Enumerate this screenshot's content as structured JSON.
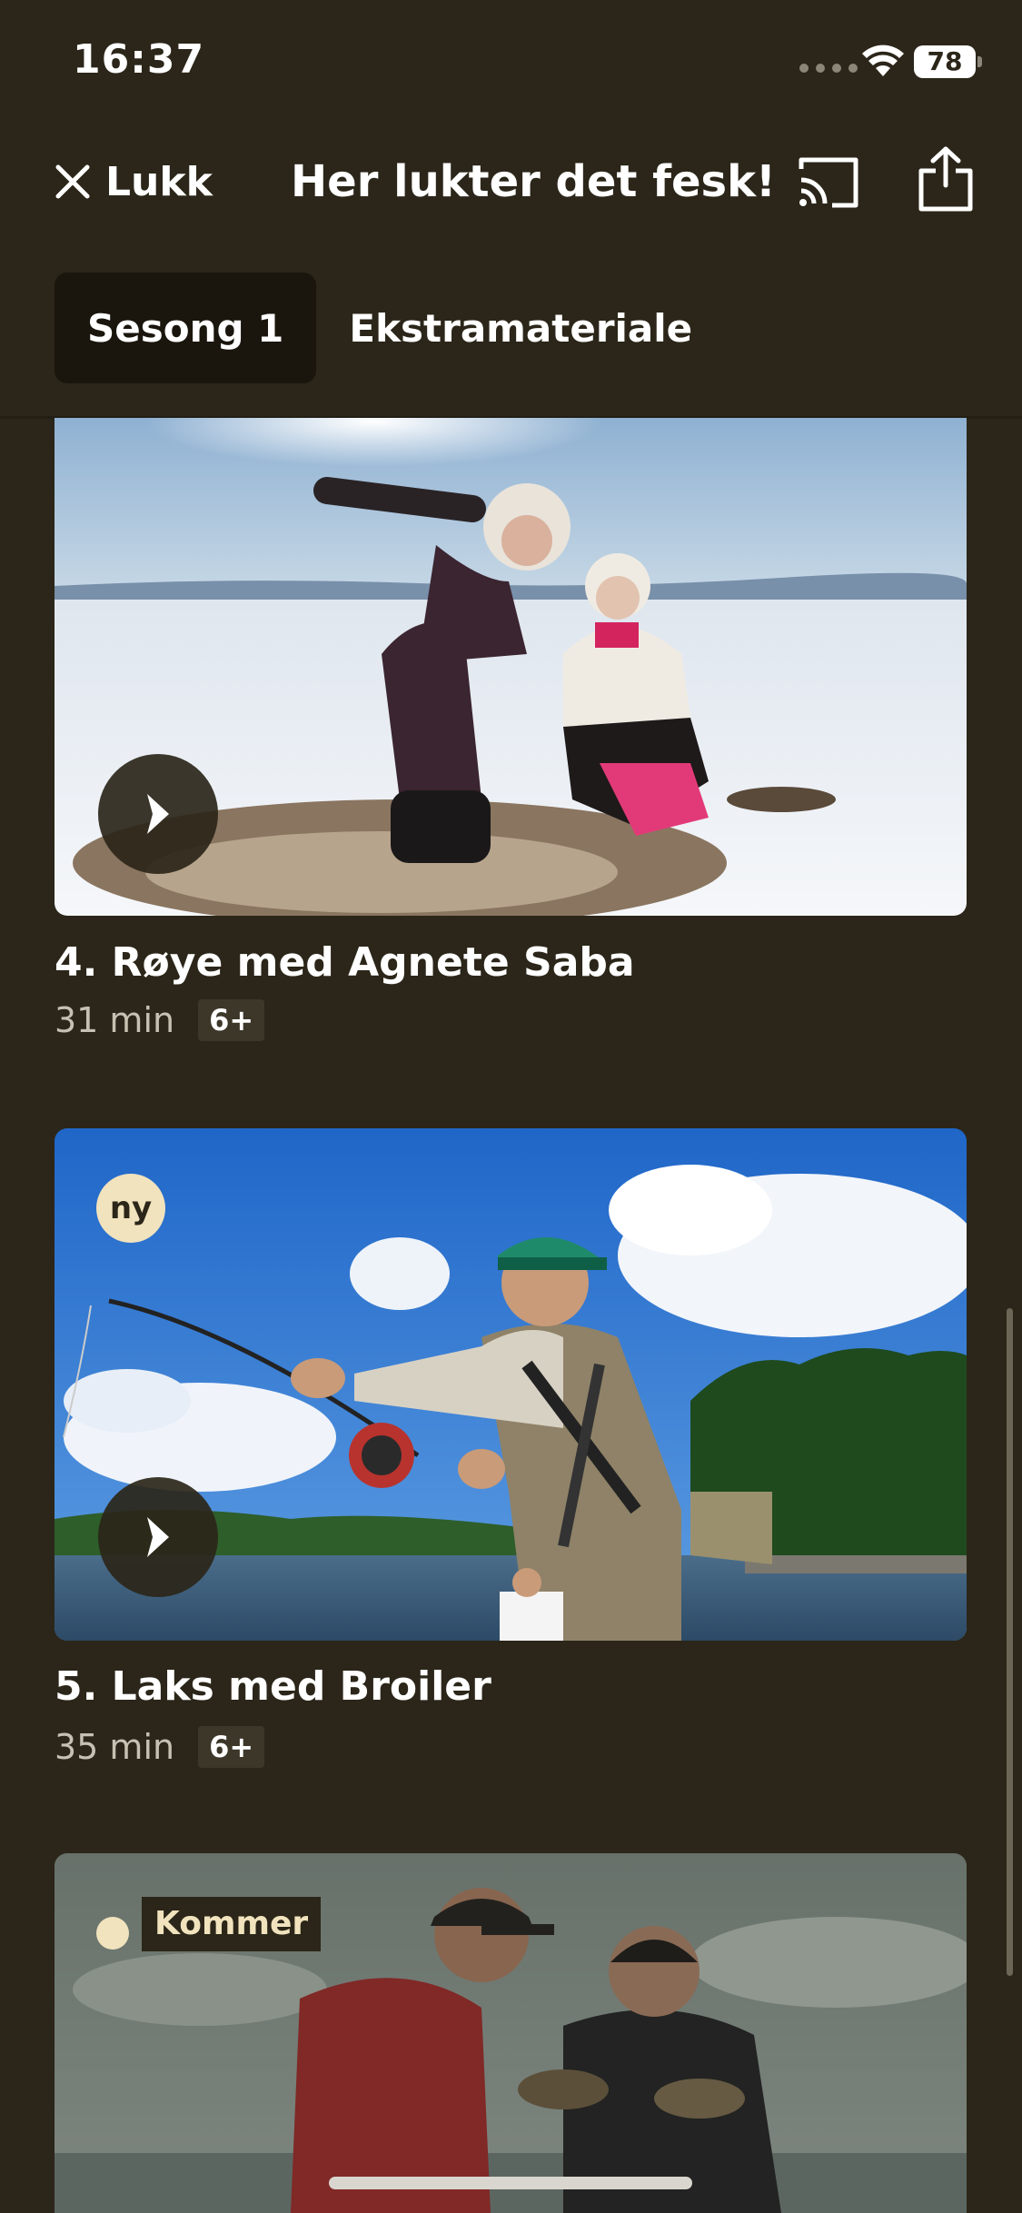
{
  "status_bar": {
    "time": "16:37",
    "battery": "78"
  },
  "header": {
    "close_label": "Lukk",
    "title": "Her lukter det fesk!"
  },
  "tabs": [
    {
      "label": "Sesong 1",
      "active": true
    },
    {
      "label": "Ekstramateriale",
      "active": false
    }
  ],
  "episodes": [
    {
      "title": "4. Røye med Agnete Saba",
      "duration": "31 min",
      "age_rating": "6+",
      "thumbnail_icon": "snow-fishing-photo"
    },
    {
      "title": "5. Laks med Broiler",
      "duration": "35 min",
      "age_rating": "6+",
      "badge": "ny",
      "thumbnail_icon": "river-fly-fishing-photo"
    },
    {
      "coming_label": "Kommer",
      "thumbnail_icon": "fish-catch-photo"
    }
  ],
  "colors": {
    "background": "#2b2619",
    "active_tab": "#1a160d",
    "badge": "#f1e3bd",
    "age_badge": "#3d372a"
  }
}
